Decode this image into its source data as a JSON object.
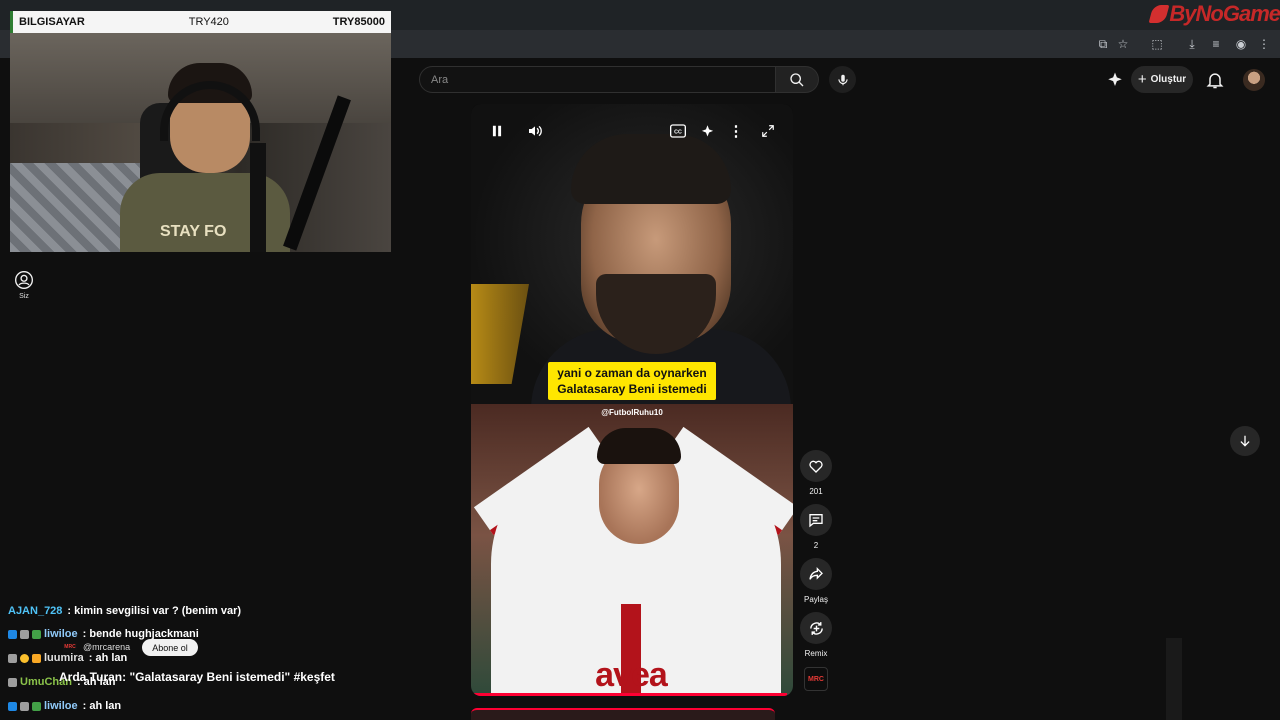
{
  "brand": {
    "logo_text": "ByNoGame"
  },
  "overlay": {
    "bet_label": "BILGISAYAR",
    "bet_amount": "TRY420",
    "bet_total": "TRY85000",
    "shirt_text": "STAY FO"
  },
  "sidebar": {
    "you_label": "Siz"
  },
  "search": {
    "placeholder": "Ara"
  },
  "header": {
    "create_label": "Oluştur"
  },
  "video": {
    "caption_line1": "yani o zaman da oynarken",
    "caption_line2": "Galatasaray Beni istemedi",
    "watermark": "@FutbolRuhu10",
    "sponsor_text": "avea",
    "progress": 0.98,
    "title": "Arda Turan: \"Galatasaray Beni istemedi\" #keşfet",
    "channel": "@mrcarena",
    "channel_badge": "MRC",
    "subscribe_label": "Abone ol"
  },
  "actions": {
    "likes": "201",
    "comments": "2",
    "share_label": "Paylaş",
    "remix_label": "Remix"
  },
  "chat": [
    {
      "user": "AJAN_728",
      "message": ": kimin sevgilisi var ? (benim var)",
      "color": "#4fc3f7"
    },
    {
      "user": "liwiloe",
      "message": ": bende hughjackmani",
      "color": "#90caf9"
    },
    {
      "user": "luumira",
      "message": ": ah lan",
      "color": "#e0e0e0"
    },
    {
      "user": "UmuChan",
      "message": ": ah lan",
      "color": "#8bc34a"
    },
    {
      "user": "liwiloe",
      "message": ": ah lan",
      "color": "#90caf9"
    }
  ]
}
